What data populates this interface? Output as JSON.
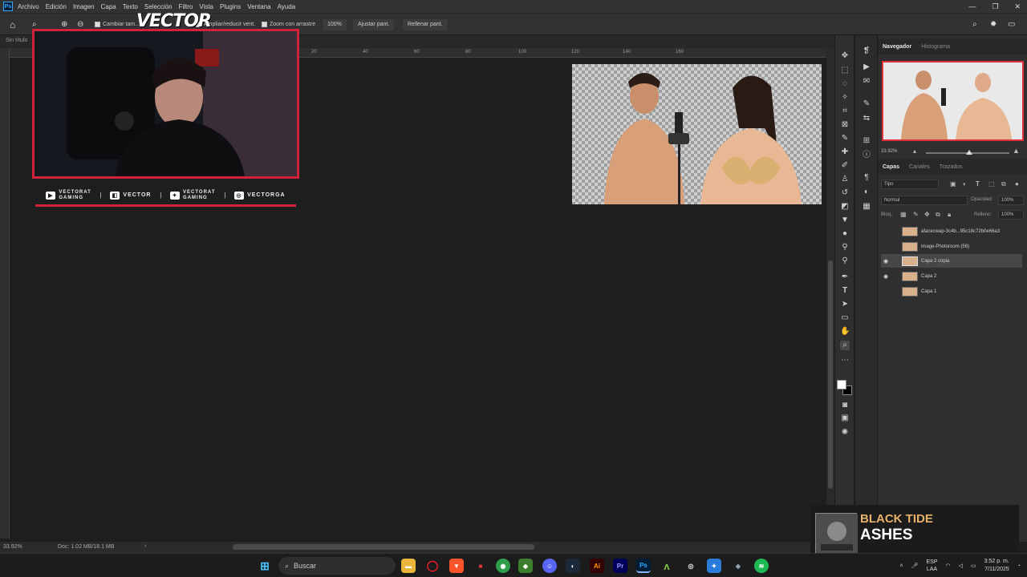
{
  "menu": [
    "Archivo",
    "Edición",
    "Imagen",
    "Capa",
    "Texto",
    "Selección",
    "Filtro",
    "Vista",
    "Plugins",
    "Ventana",
    "Ayuda"
  ],
  "options_bar": {
    "partial_option": "Cambiar tam...",
    "chk_resize": "Ampliar/reducir vent.",
    "chk_drag": "Zoom con arrastre",
    "zoom_value": "100%",
    "btn_fit": "Ajustar pant.",
    "btn_fill": "Rellenar pant."
  },
  "doc_tab": "Sin título",
  "ruler_labels": [
    "20",
    "40",
    "60",
    "80",
    "100",
    "120",
    "140",
    "160"
  ],
  "status": {
    "zoom": "33.92%",
    "doc": "Doc: 1.02 MB/18.1 MB"
  },
  "navigator": {
    "tabs": [
      "Navegador",
      "Histograma"
    ],
    "zoom": "33.92%"
  },
  "layers_panel": {
    "tabs": [
      "Capas",
      "Canales",
      "Trazados"
    ],
    "filter": "Tipo",
    "blend_mode": "Normal",
    "opacity_label": "Opacidad:",
    "opacity_value": "100%",
    "lock_label": "Bloq.:",
    "fill_label": "Relleno:",
    "fill_value": "100%",
    "layers": [
      {
        "name": "afacecwap-3c4b...95c18c72b0e66a3",
        "visible": false,
        "selected": false
      },
      {
        "name": "image-Photoroom (56)",
        "visible": false,
        "selected": false
      },
      {
        "name": "Capa 2 copia",
        "visible": true,
        "selected": true
      },
      {
        "name": "Capa 2",
        "visible": true,
        "selected": false
      },
      {
        "name": "Capa 1",
        "visible": false,
        "selected": false
      }
    ]
  },
  "overlay": {
    "title": "VECTOR",
    "socials": [
      {
        "icon": "youtube-icon",
        "glyph": "▶",
        "label": "VECTORAT\nGAMING"
      },
      {
        "icon": "twitch-icon",
        "glyph": "◧",
        "label": "VECTOR"
      },
      {
        "icon": "twitter-icon",
        "glyph": "✦",
        "label": "VECTORAT\nGAMING"
      },
      {
        "icon": "instagram-icon",
        "glyph": "◎",
        "label": "VECTORGA"
      }
    ]
  },
  "now_playing": {
    "artist": "BLACK TIDE",
    "track": "ASHES"
  },
  "taskbar": {
    "search": "Buscar",
    "lang_top": "ESP",
    "lang_bottom": "LAA",
    "time": "3:52 p. m.",
    "date": "7/11/2025"
  },
  "colors": {
    "accent_red": "#d0223a",
    "ps_blue": "#31a8ff"
  }
}
